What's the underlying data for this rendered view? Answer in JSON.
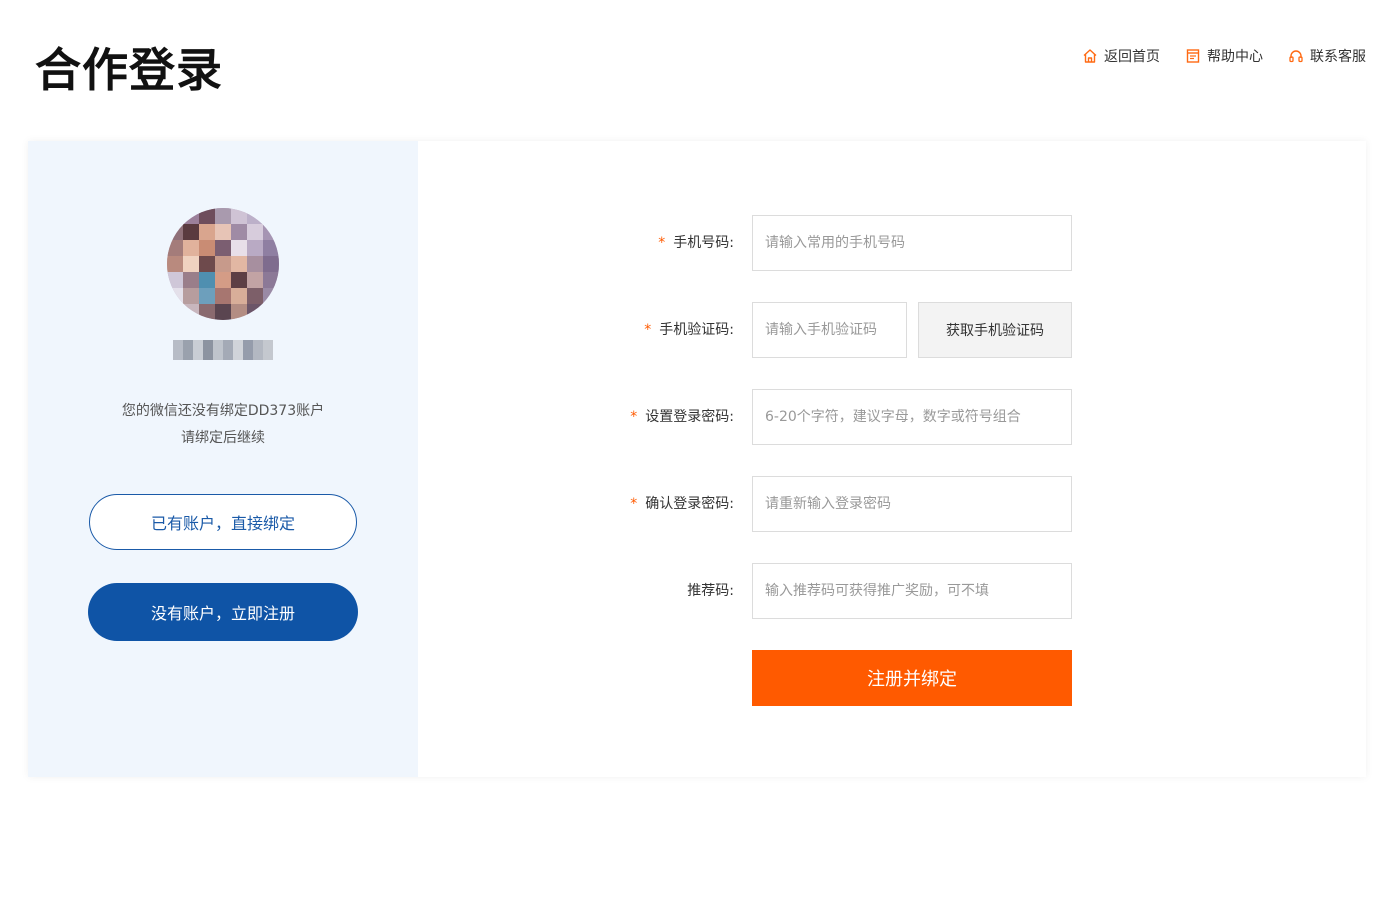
{
  "header": {
    "title": "合作登录",
    "nav": [
      {
        "label": "返回首页",
        "icon": "home-icon"
      },
      {
        "label": "帮助中心",
        "icon": "book-icon"
      },
      {
        "label": "联系客服",
        "icon": "headset-icon"
      }
    ]
  },
  "colors": {
    "accent": "#ff5a00",
    "primary": "#0f54a6",
    "left_panel_bg": "#f0f6fd"
  },
  "left": {
    "message_line1": "您的微信还没有绑定DD373账户",
    "message_line2": "请绑定后继续",
    "bind_existing_label": "已有账户，直接绑定",
    "register_label": "没有账户，立即注册"
  },
  "form": {
    "phone": {
      "required_mark": "*",
      "label": "手机号码:",
      "placeholder": "请输入常用的手机号码"
    },
    "sms_code": {
      "required_mark": "*",
      "label": "手机验证码:",
      "placeholder": "请输入手机验证码",
      "button_label": "获取手机验证码"
    },
    "password": {
      "required_mark": "*",
      "label": "设置登录密码:",
      "placeholder": "6-20个字符，建议字母，数字或符号组合"
    },
    "confirm_password": {
      "required_mark": "*",
      "label": "确认登录密码:",
      "placeholder": "请重新输入登录密码"
    },
    "referral": {
      "label": "推荐码:",
      "placeholder": "输入推荐码可获得推广奖励，可不填"
    },
    "submit_label": "注册并绑定"
  }
}
